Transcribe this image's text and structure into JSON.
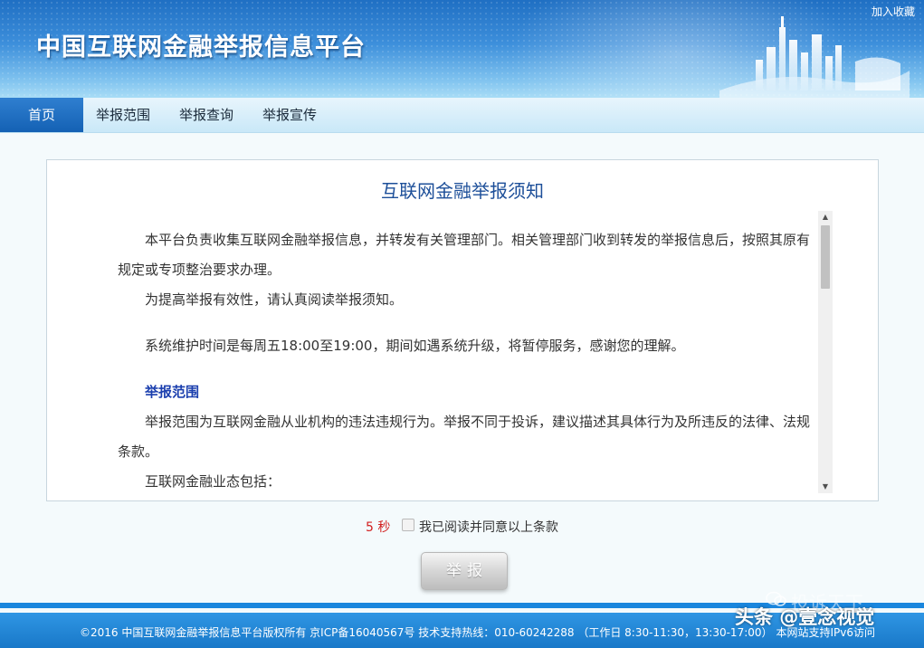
{
  "header": {
    "site_title": "中国互联网金融举报信息平台",
    "bookmark_label": "加入收藏"
  },
  "nav": {
    "items": [
      {
        "label": "首页",
        "active": true
      },
      {
        "label": "举报范围",
        "active": false
      },
      {
        "label": "举报查询",
        "active": false
      },
      {
        "label": "举报宣传",
        "active": false
      }
    ]
  },
  "notice": {
    "title": "互联网金融举报须知",
    "paragraphs": [
      "本平台负责收集互联网金融举报信息，并转发有关管理部门。相关管理部门收到转发的举报信息后，按照其原有规定或专项整治要求办理。",
      "为提高举报有效性，请认真阅读举报须知。",
      "系统维护时间是每周五18:00至19:00，期间如遇系统升级，将暂停服务，感谢您的理解。"
    ],
    "section_heading": "举报范围",
    "section_paragraph": "举报范围为互联网金融从业机构的违法违规行为。举报不同于投诉，建议描述其具体行为及所违反的法律、法规条款。",
    "partial_line": "互联网金融业态包括："
  },
  "agreement": {
    "countdown": "5 秒",
    "label": "我已阅读并同意以上条款",
    "checked": false
  },
  "submit": {
    "label": "举报"
  },
  "footer": {
    "copyright": "©2016 中国互联网金融举报信息平台版权所有 京ICP备16040567号 技术支持热线：010-60242288 （工作日 8:30-11:30，13:30-17:00）",
    "ipv6_note": "本网站支持IPv6访问"
  },
  "watermark": {
    "top": "投诉天下",
    "bottom": "头条 @壹念视觉"
  },
  "colors": {
    "brand_blue": "#1461b4",
    "heading_blue": "#1d4f99",
    "countdown_red": "#d21f1f",
    "footer_blue": "#1978c8"
  }
}
